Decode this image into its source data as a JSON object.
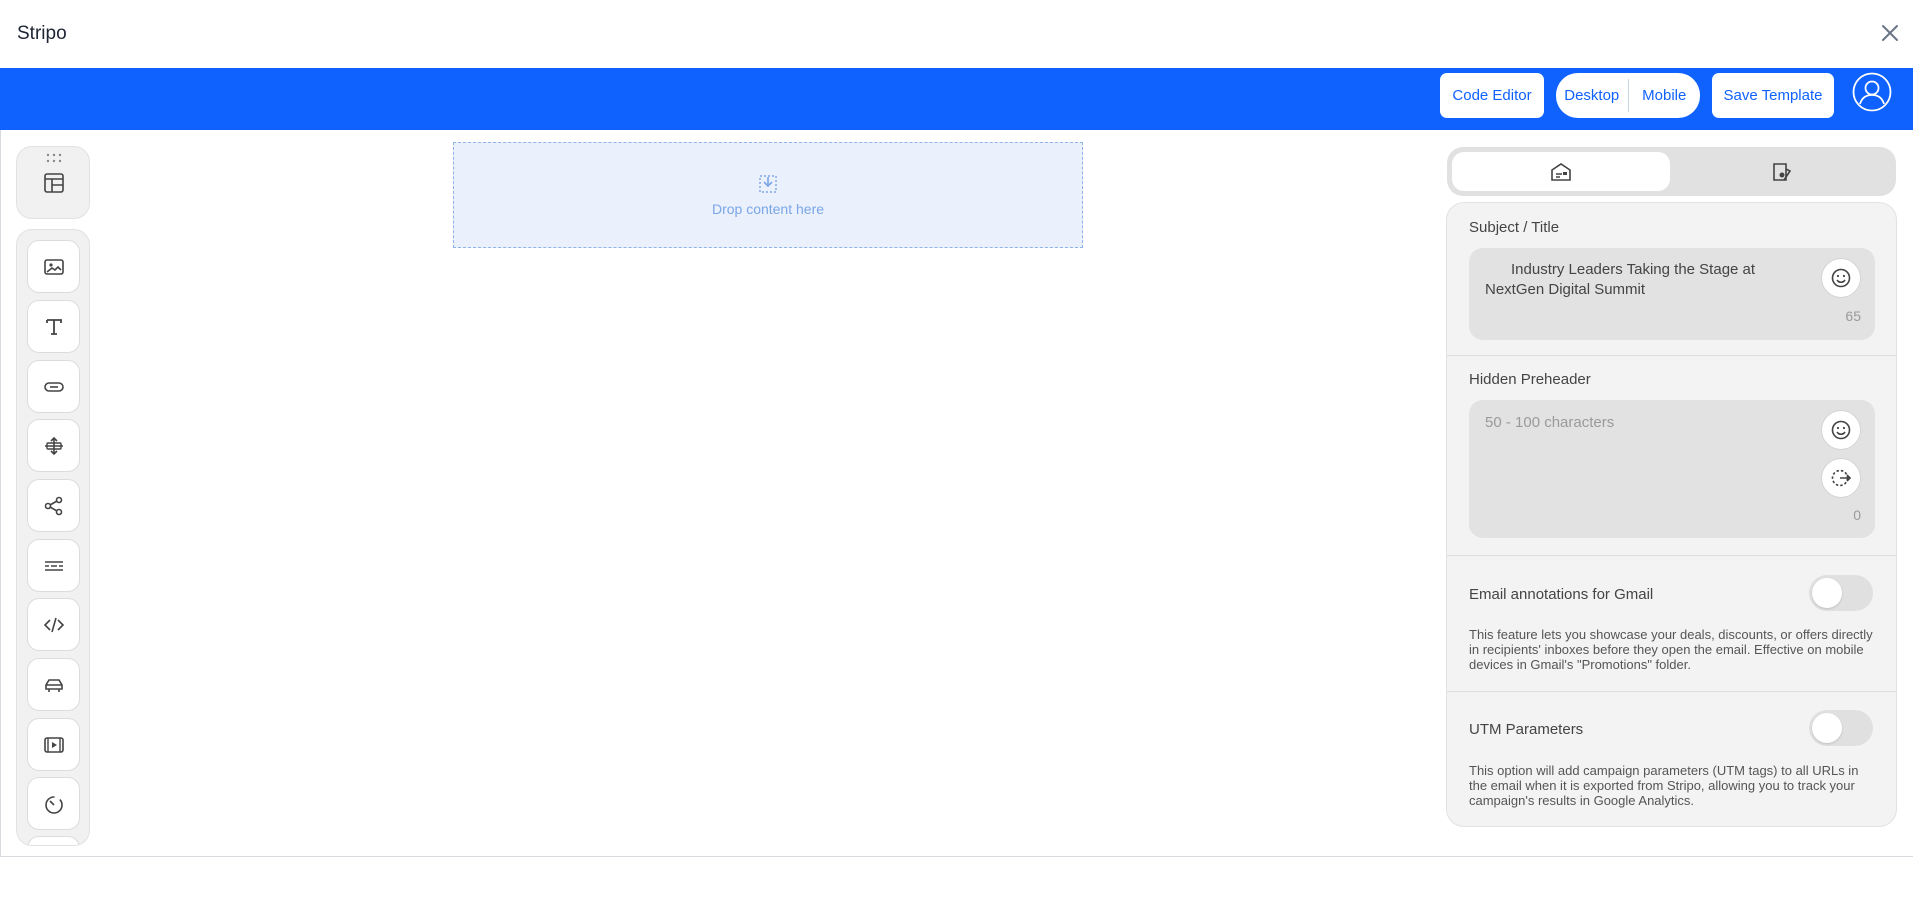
{
  "app": {
    "title": "Stripo"
  },
  "toolbar": {
    "code_editor_label": "Code Editor",
    "desktop_label": "Desktop",
    "mobile_label": "Mobile",
    "save_template_label": "Save Template"
  },
  "canvas": {
    "drop_label": "Drop content here"
  },
  "left_rail": {
    "tools": [
      "image-icon",
      "text-icon",
      "button-icon",
      "spacer-icon",
      "social-icon",
      "banner-icon",
      "html-icon",
      "menu-icon",
      "video-icon",
      "timer-icon"
    ]
  },
  "panel": {
    "subject": {
      "label": "Subject / Title",
      "value": "Industry Leaders Taking the Stage at NextGen Digital Summit",
      "count": "65"
    },
    "preheader": {
      "label": "Hidden Preheader",
      "placeholder": "50 - 100 characters",
      "count": "0"
    },
    "gmail": {
      "label": "Email annotations for Gmail",
      "enabled": false,
      "description": "This feature lets you showcase your deals, discounts, or offers directly in recipients' inboxes before they open the email. Effective on mobile devices in Gmail's \"Promotions\" folder."
    },
    "utm": {
      "label": "UTM Parameters",
      "enabled": false,
      "description": "This option will add campaign parameters (UTM tags) to all URLs in the email when it is exported from Stripo, allowing you to track your campaign's results in Google Analytics."
    }
  },
  "colors": {
    "brand": "#1062fe",
    "drop_zone_bg": "#eaf1fc",
    "drop_zone_text": "#7aa5e6"
  }
}
